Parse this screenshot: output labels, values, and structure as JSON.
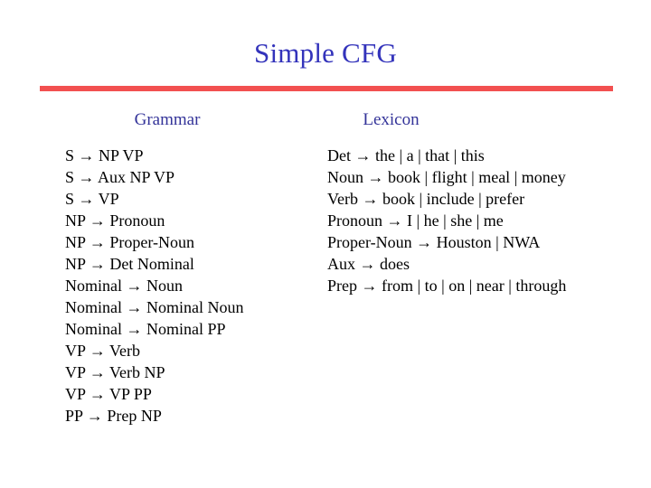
{
  "slide": {
    "title": "Simple CFG",
    "accent_color": "#f25050",
    "title_color": "#3333bb",
    "header_color": "#333399",
    "background_color": "#ffffff"
  },
  "grammar": {
    "header": "Grammar",
    "rules": [
      "S → NP VP",
      "S → Aux NP VP",
      "S → VP",
      "NP → Pronoun",
      "NP → Proper-Noun",
      "NP → Det Nominal",
      "Nominal → Noun",
      "Nominal → Nominal Noun",
      "Nominal → Nominal PP",
      "VP → Verb",
      "VP → Verb NP",
      "VP → VP PP",
      "PP → Prep NP"
    ]
  },
  "lexicon": {
    "header": "Lexicon",
    "rules": [
      "Det → the | a | that | this",
      "Noun → book | flight | meal | money",
      "Verb → book | include | prefer",
      "Pronoun → I | he | she | me",
      "Proper-Noun → Houston | NWA",
      "Aux → does",
      "Prep → from | to | on | near | through"
    ]
  }
}
